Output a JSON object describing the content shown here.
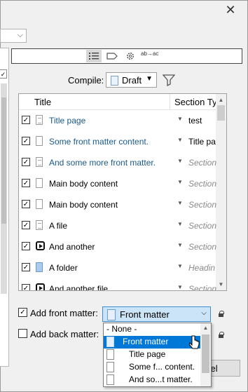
{
  "window": {
    "close_glyph": "✕"
  },
  "toolbar": {
    "list_icon": "list-icon",
    "label_icon": "label-icon",
    "gear_icon": "gear-icon",
    "replace_glyph": "ab→ac"
  },
  "compile": {
    "label": "Compile:",
    "value": "Draft",
    "arrow": "▼"
  },
  "table": {
    "columns": [
      "Title",
      "Section Type"
    ],
    "rows": [
      {
        "checked": true,
        "icon": "document-icon",
        "title": "Title page",
        "section": "test",
        "italic": false
      },
      {
        "checked": true,
        "icon": "blank-document-icon",
        "title": "Some front matter content.",
        "section": "Title pa",
        "italic": false
      },
      {
        "checked": true,
        "icon": "document-icon",
        "title": "And some more front matter.",
        "section": "Section",
        "italic": true
      },
      {
        "checked": true,
        "icon": "blank-document-icon",
        "title": "Main body content",
        "section": "Section",
        "italic": true
      },
      {
        "checked": true,
        "icon": "blank-document-icon",
        "title": "Main body content",
        "section": "Section",
        "italic": true
      },
      {
        "checked": true,
        "icon": "document-icon",
        "title": "A file",
        "section": "Section",
        "italic": true
      },
      {
        "checked": true,
        "icon": "play-icon",
        "title": "And another",
        "section": "Section",
        "italic": true
      },
      {
        "checked": true,
        "icon": "folder-icon",
        "title": "A folder",
        "section": "Headin",
        "italic": true
      },
      {
        "checked": true,
        "icon": "play-icon",
        "title": "And another file",
        "section": "Section",
        "italic": true
      }
    ]
  },
  "front_matter": {
    "label": "Add front matter:",
    "checked": true,
    "value": "Front matter"
  },
  "back_matter": {
    "label": "Add back matter:",
    "checked": false
  },
  "dropdown": {
    "items": [
      {
        "label": "- None -",
        "icon": "",
        "selected": false,
        "indent": 0
      },
      {
        "label": "Front matter",
        "icon": "front-matter-icon",
        "selected": true,
        "indent": 0
      },
      {
        "label": "Title page",
        "icon": "document-icon",
        "selected": false,
        "indent": 1
      },
      {
        "label": "Some f... content.",
        "icon": "blank-document-icon",
        "selected": false,
        "indent": 1
      },
      {
        "label": "And so...t matter.",
        "icon": "blank-document-icon",
        "selected": false,
        "indent": 1
      },
      {
        "label": "",
        "icon": "image-icon",
        "selected": false,
        "indent": 0
      }
    ]
  },
  "buttons": {
    "cancel": "cel"
  },
  "colors": {
    "highlight": "#7fd0f2",
    "selection": "#0078d7",
    "combo_focus": "#cce4f7"
  }
}
